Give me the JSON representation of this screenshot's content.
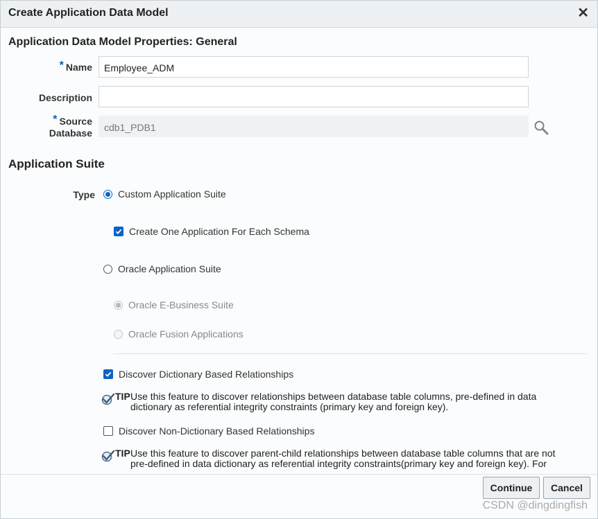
{
  "dialog": {
    "title": "Create Application Data Model",
    "close_glyph": "✕"
  },
  "general": {
    "heading": "Application Data Model Properties: General",
    "name": {
      "required_mark": "*",
      "label": "Name",
      "value": "Employee_ADM"
    },
    "description": {
      "label": "Description",
      "value": ""
    },
    "source_database": {
      "required_mark": "*",
      "label_line1": "Source",
      "label_line2": "Database",
      "value": "cdb1_PDB1",
      "search_icon": "search-icon"
    }
  },
  "suite": {
    "heading": "Application Suite",
    "type_label": "Type",
    "custom_suite": {
      "label": "Custom Application Suite",
      "selected": true
    },
    "create_one_app": {
      "label": "Create One Application For Each Schema",
      "checked": true
    },
    "oracle_suite": {
      "label": "Oracle Application Suite",
      "selected": false
    },
    "ebs": {
      "label": "Oracle E-Business Suite",
      "selected": true,
      "disabled": true
    },
    "fusion": {
      "label": "Oracle Fusion Applications",
      "selected": false,
      "disabled": true
    }
  },
  "discovery": {
    "dictionary": {
      "label": "Discover Dictionary Based Relationships",
      "checked": true
    },
    "tip1": {
      "label": "TIP",
      "line1": "Use this feature to discover relationships between database table columns, pre-defined in data",
      "line2": "dictionary as referential integrity constraints (primary key and foreign key)."
    },
    "non_dictionary": {
      "label": "Discover Non-Dictionary Based Relationships",
      "checked": false
    },
    "tip2": {
      "label": "TIP",
      "line1": "Use this feature to discover parent-child relationships between database table columns that are not",
      "line2": "pre-defined in data dictionary as referential integrity constraints(primary key and foreign key). For"
    }
  },
  "footer": {
    "continue_label": "Continue",
    "cancel_label": "Cancel",
    "watermark": "CSDN @dingdingfish"
  },
  "colors": {
    "accent": "#0b63c5",
    "required": "#0a5fb4"
  }
}
